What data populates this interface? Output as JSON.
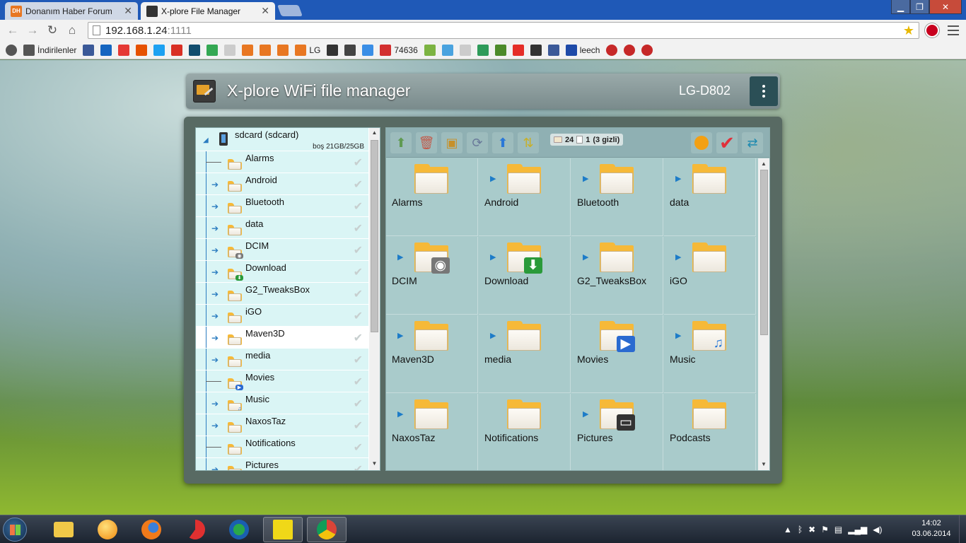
{
  "browser": {
    "tabs": [
      {
        "title": "Donanım Haber Forum",
        "favicon": "DH"
      },
      {
        "title": "X-plore File Manager",
        "favicon": "xplore"
      }
    ],
    "address": {
      "host": "192.168.1.24",
      "port": ":1111"
    },
    "window_controls": [
      "minimize",
      "maximize",
      "close"
    ]
  },
  "bookmarks": [
    {
      "icon": "apps-icon",
      "label": ""
    },
    {
      "icon": "download-arrow-icon",
      "label": "İndirilenler"
    },
    {
      "icon": "facebook-icon",
      "label": ""
    },
    {
      "icon": "m-icon",
      "label": ""
    },
    {
      "icon": "fire-icon",
      "label": ""
    },
    {
      "icon": "bolt-icon",
      "label": ""
    },
    {
      "icon": "twitter-icon",
      "label": ""
    },
    {
      "icon": "gmail-icon",
      "label": ""
    },
    {
      "icon": "v-icon",
      "label": ""
    },
    {
      "icon": "play-store-icon",
      "label": ""
    },
    {
      "icon": "page-icon",
      "label": ""
    },
    {
      "icon": "dh-icon",
      "label": ""
    },
    {
      "icon": "dh-icon",
      "label": ""
    },
    {
      "icon": "dh-icon",
      "label": ""
    },
    {
      "icon": "dh-icon",
      "label": "LG"
    },
    {
      "icon": "xda-icon",
      "label": ""
    },
    {
      "icon": "y-icon",
      "label": ""
    },
    {
      "icon": "drop-icon",
      "label": ""
    },
    {
      "icon": "huawei-icon",
      "label": "74636"
    },
    {
      "icon": "android-icon",
      "label": ""
    },
    {
      "icon": "circle-icon",
      "label": ""
    },
    {
      "icon": "page-icon",
      "label": ""
    },
    {
      "icon": "swirl-icon",
      "label": ""
    },
    {
      "icon": "landscape-icon",
      "label": ""
    },
    {
      "icon": "youtube-icon",
      "label": ""
    },
    {
      "icon": "xplore-icon",
      "label": ""
    },
    {
      "icon": "facebook-icon",
      "label": ""
    },
    {
      "icon": "fl-icon",
      "label": "leech"
    },
    {
      "icon": "ladybug-icon",
      "label": ""
    },
    {
      "icon": "ladybug-icon",
      "label": ""
    },
    {
      "icon": "ladybug-icon",
      "label": ""
    }
  ],
  "app": {
    "title": "X-plore WiFi file manager",
    "device": "LG-D802"
  },
  "tree": {
    "root": {
      "label": "sdcard (sdcard)",
      "free": "boş 21GB/25GB"
    },
    "items": [
      {
        "label": "Alarms",
        "expandable": false,
        "icon": "folder"
      },
      {
        "label": "Android",
        "expandable": true,
        "icon": "folder"
      },
      {
        "label": "Bluetooth",
        "expandable": true,
        "icon": "folder"
      },
      {
        "label": "data",
        "expandable": true,
        "icon": "folder"
      },
      {
        "label": "DCIM",
        "expandable": true,
        "icon": "camera-folder"
      },
      {
        "label": "Download",
        "expandable": true,
        "icon": "download-folder"
      },
      {
        "label": "G2_TweaksBox",
        "expandable": true,
        "icon": "folder"
      },
      {
        "label": "iGO",
        "expandable": true,
        "icon": "folder"
      },
      {
        "label": "Maven3D",
        "expandable": true,
        "icon": "folder",
        "selected": true
      },
      {
        "label": "media",
        "expandable": true,
        "icon": "folder"
      },
      {
        "label": "Movies",
        "expandable": false,
        "icon": "movie-folder"
      },
      {
        "label": "Music",
        "expandable": true,
        "icon": "music-folder"
      },
      {
        "label": "NaxosTaz",
        "expandable": true,
        "icon": "folder"
      },
      {
        "label": "Notifications",
        "expandable": false,
        "icon": "folder"
      },
      {
        "label": "Pictures",
        "expandable": true,
        "icon": "picture-folder"
      }
    ]
  },
  "toolbar": {
    "folders": "24",
    "files": "1",
    "hidden": "(3 gizli)"
  },
  "grid": [
    {
      "label": "Alarms",
      "expandable": false,
      "icon": "folder"
    },
    {
      "label": "Android",
      "expandable": true,
      "icon": "folder"
    },
    {
      "label": "Bluetooth",
      "expandable": true,
      "icon": "folder"
    },
    {
      "label": "data",
      "expandable": true,
      "icon": "folder"
    },
    {
      "label": "DCIM",
      "expandable": true,
      "icon": "camera-folder"
    },
    {
      "label": "Download",
      "expandable": true,
      "icon": "download-folder"
    },
    {
      "label": "G2_TweaksBox",
      "expandable": true,
      "icon": "folder"
    },
    {
      "label": "iGO",
      "expandable": true,
      "icon": "folder"
    },
    {
      "label": "Maven3D",
      "expandable": true,
      "icon": "folder"
    },
    {
      "label": "media",
      "expandable": true,
      "icon": "folder"
    },
    {
      "label": "Movies",
      "expandable": false,
      "icon": "movie-folder"
    },
    {
      "label": "Music",
      "expandable": true,
      "icon": "music-folder"
    },
    {
      "label": "NaxosTaz",
      "expandable": true,
      "icon": "folder"
    },
    {
      "label": "Notifications",
      "expandable": false,
      "icon": "folder"
    },
    {
      "label": "Pictures",
      "expandable": true,
      "icon": "picture-folder"
    },
    {
      "label": "Podcasts",
      "expandable": false,
      "icon": "folder"
    }
  ],
  "taskbar": {
    "apps": [
      "file-explorer",
      "orange-ball",
      "firefox",
      "ccleaner",
      "download-manager",
      "avast",
      "chrome"
    ],
    "clock_time": "14:02",
    "clock_date": "03.06.2014"
  },
  "colors": {
    "accent": "#1d7cc8",
    "folder": "#f6b938",
    "tree_bg": "#daf5f5",
    "grid_bg": "#a9cbcb"
  }
}
